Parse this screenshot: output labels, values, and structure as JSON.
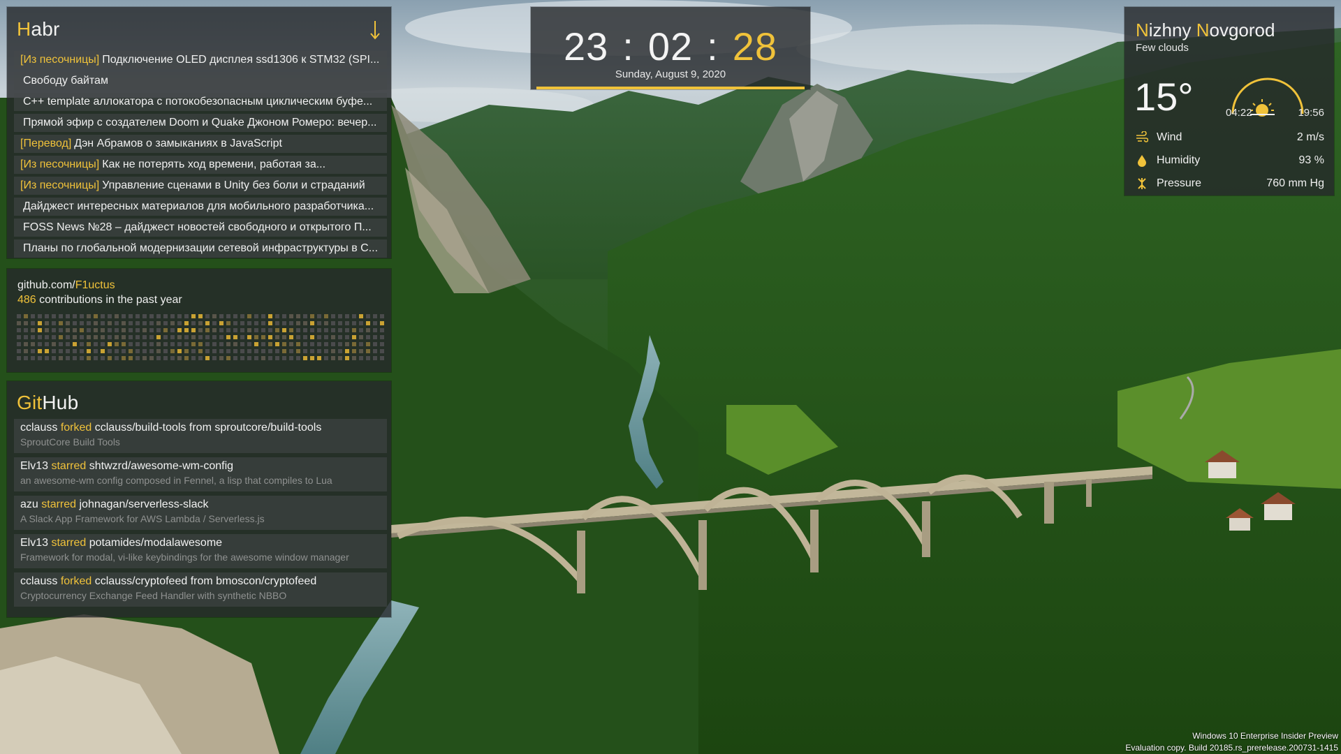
{
  "colors": {
    "accent": "#f0c23a",
    "panel": "rgba(38,40,42,0.80)"
  },
  "habr": {
    "title_first": "H",
    "title_rest": "abr",
    "refresh_icon": "arrow-down-icon",
    "items": [
      {
        "tag": "[Из песочницы]",
        "text": "Подключение OLED дисплея ssd1306 к STM32 (SPI..."
      },
      {
        "tag": "",
        "text": "Свободу байтам"
      },
      {
        "tag": "",
        "text": "C++ template аллокатора с потокобезопасным циклическим буфе..."
      },
      {
        "tag": "",
        "text": "Прямой эфир с создателем Doom и Quake Джоном Ромеро: вечер..."
      },
      {
        "tag": "[Перевод]",
        "text": "Дэн Абрамов о замыканиях в JavaScript"
      },
      {
        "tag": "[Из песочницы]",
        "text": "Как не потерять ход времени, работая за..."
      },
      {
        "tag": "[Из песочницы]",
        "text": "Управление сценами в Unity без боли и страданий"
      },
      {
        "tag": "",
        "text": "Дайджест интересных материалов для мобильного разработчика..."
      },
      {
        "tag": "",
        "text": "FOSS News №28 – дайджест новостей свободного и открытого П..."
      },
      {
        "tag": "",
        "text": "Планы по глобальной модернизации сетевой инфраструктуры в С..."
      }
    ]
  },
  "contrib": {
    "url_prefix": "github.com/",
    "user": "F1uctus",
    "count": "486",
    "count_suffix": " contributions in the past year"
  },
  "github": {
    "title_first": "Git",
    "title_rest": "Hub",
    "events": [
      {
        "user": "cclauss",
        "action": "forked",
        "rest": "cclauss/build-tools from sproutcore/build-tools",
        "desc": "SproutCore Build Tools"
      },
      {
        "user": "Elv13",
        "action": "starred",
        "rest": "shtwzrd/awesome-wm-config",
        "desc": "an awesome-wm config composed in Fennel, a lisp that compiles to Lua"
      },
      {
        "user": "azu",
        "action": "starred",
        "rest": "johnagan/serverless-slack",
        "desc": "A Slack App Framework for AWS Lambda / Serverless.js"
      },
      {
        "user": "Elv13",
        "action": "starred",
        "rest": "potamides/modalawesome",
        "desc": "Framework for modal, vi-like keybindings for the awesome window manager"
      },
      {
        "user": "cclauss",
        "action": "forked",
        "rest": "cclauss/cryptofeed from bmoscon/cryptofeed",
        "desc": "Cryptocurrency Exchange Feed Handler with synthetic NBBO"
      }
    ]
  },
  "clock": {
    "hours": "23",
    "minutes": "02",
    "seconds": "28",
    "separator": ":",
    "date": "Sunday, August 9, 2020"
  },
  "weather": {
    "city_n1": "N",
    "city_r1": "izhny ",
    "city_n2": "N",
    "city_r2": "ovgorod",
    "condition": "Few clouds",
    "temperature": "15°",
    "sunrise": "04:22",
    "sunset": "19:56",
    "rows": [
      {
        "icon": "wind-icon",
        "label": "Wind",
        "value": "2 m/s"
      },
      {
        "icon": "droplet-icon",
        "label": "Humidity",
        "value": "93 %"
      },
      {
        "icon": "pressure-icon",
        "label": "Pressure",
        "value": "760 mm Hg"
      }
    ]
  },
  "watermark": {
    "line1": "Windows 10 Enterprise Insider Preview",
    "line2": "Evaluation copy. Build 20185.rs_prerelease.200731-1415"
  }
}
